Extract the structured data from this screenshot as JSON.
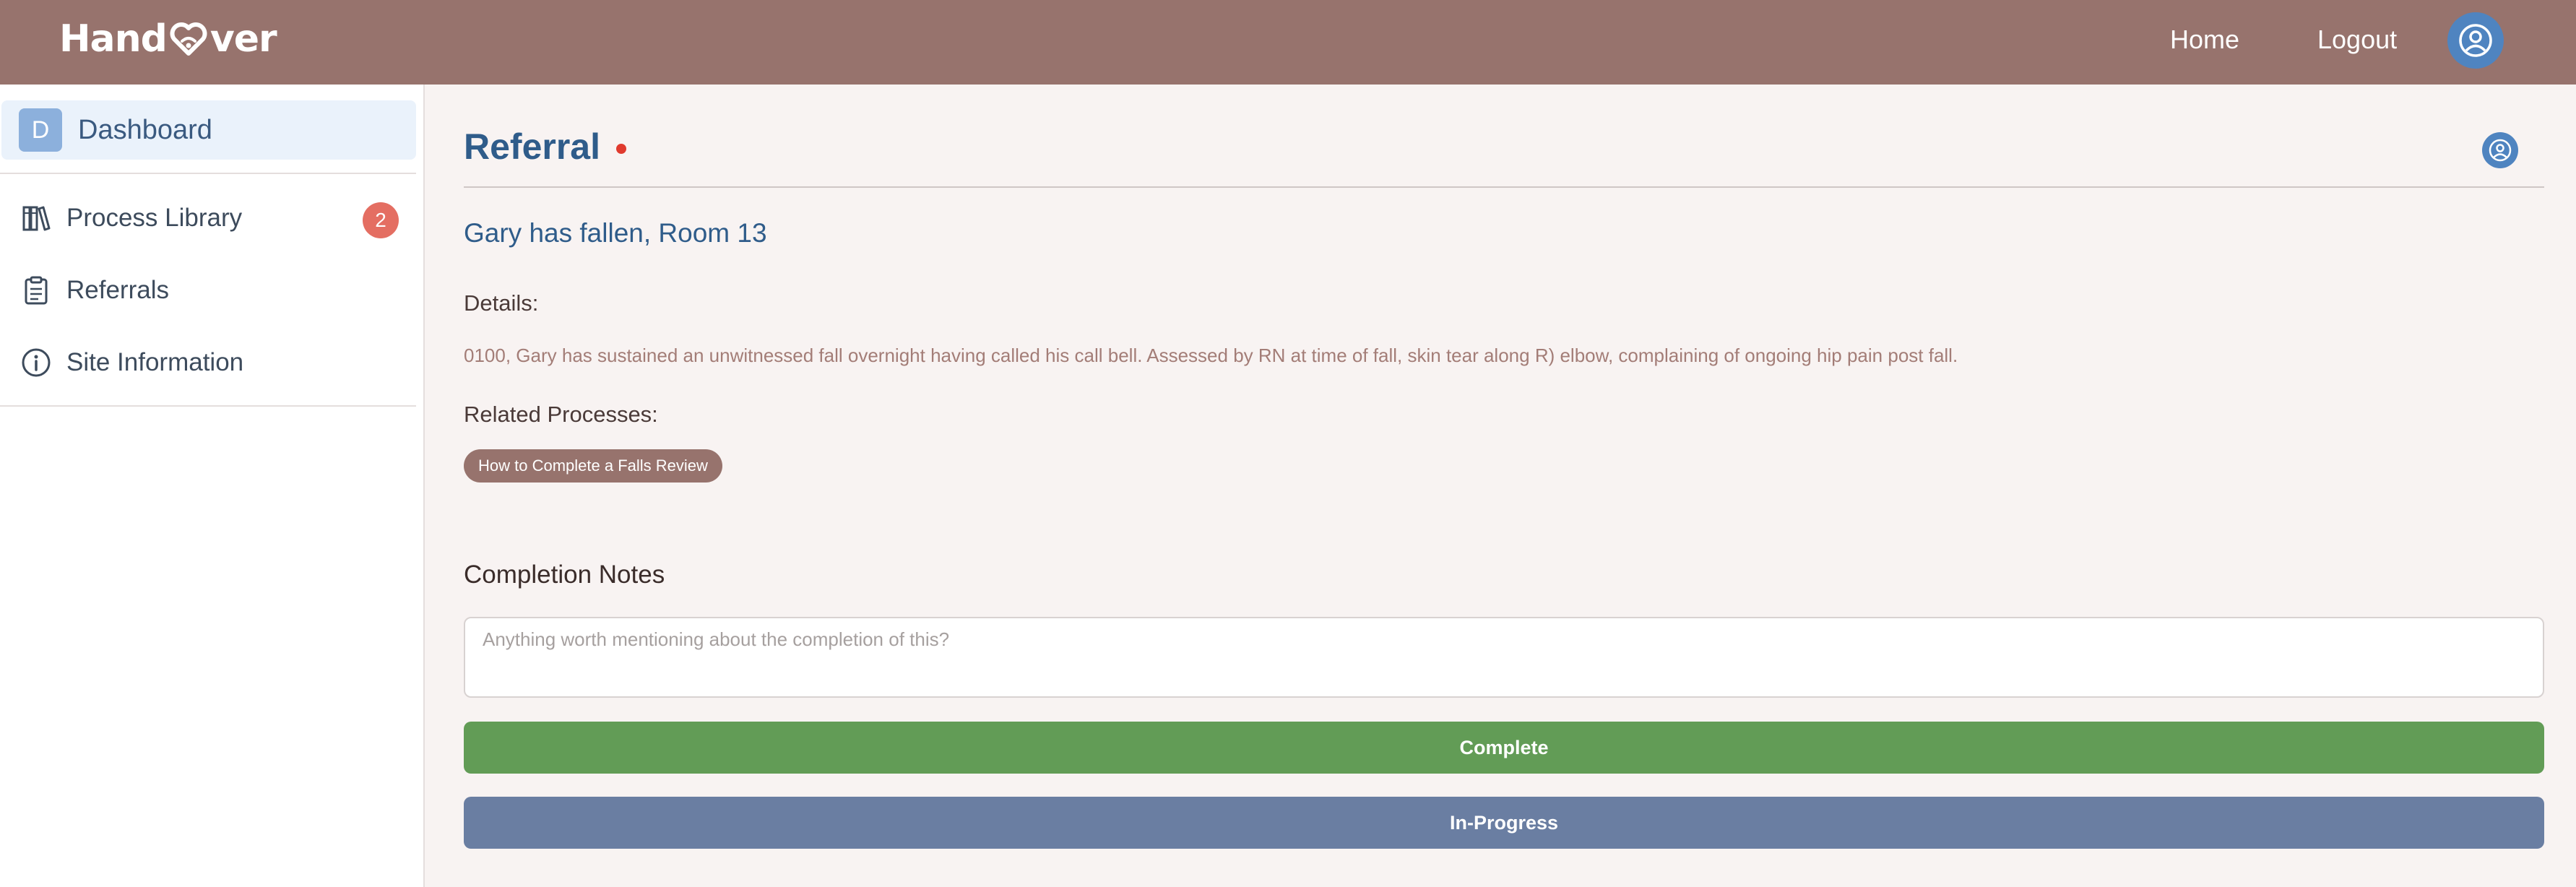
{
  "header": {
    "logo_left": "Hand",
    "logo_right": "ver",
    "home_label": "Home",
    "logout_label": "Logout"
  },
  "sidebar": {
    "dashboard": {
      "initial": "D",
      "label": "Dashboard"
    },
    "items": [
      {
        "label": "Process Library",
        "icon": "library-icon",
        "count": "2"
      },
      {
        "label": "Referrals",
        "icon": "clipboard-icon"
      },
      {
        "label": "Site Information",
        "icon": "info-icon"
      }
    ]
  },
  "referral": {
    "title": "Referral",
    "subject": "Gary has fallen, Room 13",
    "details_label": "Details:",
    "details_text": "0100, Gary has sustained an unwitnessed fall overnight having called his call bell. Assessed by RN at time of fall, skin tear along R) elbow, complaining of ongoing hip pain post fall.",
    "related_label": "Related Processes:",
    "related_processes": [
      "How to Complete a Falls Review"
    ]
  },
  "completion": {
    "label": "Completion Notes",
    "placeholder": "Anything worth mentioning about the completion of this?",
    "value": "",
    "complete_label": "Complete",
    "in_progress_label": "In-Progress"
  },
  "colors": {
    "header_bg": "#97736d",
    "accent_blue": "#2f5c8a",
    "complete_green": "#629c56",
    "in_progress_blue": "#6a7ea2",
    "badge_red": "#e46e62"
  }
}
